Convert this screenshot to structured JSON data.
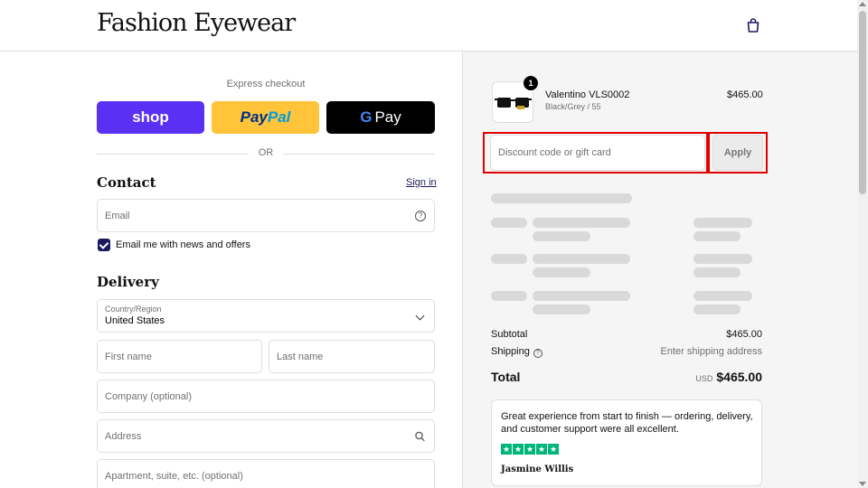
{
  "header": {
    "logo": "Fashion Eyewear",
    "bag_icon": "shopping-bag-icon"
  },
  "express": {
    "label": "Express checkout",
    "shop_label": "shop",
    "paypal_label_1": "Pay",
    "paypal_label_2": "Pal",
    "gpay_g": "G",
    "gpay_label": "Pay",
    "or_label": "OR"
  },
  "contact": {
    "title": "Contact",
    "sign_in": "Sign in",
    "email_placeholder": "Email",
    "news_checkbox_label": "Email me with news and offers",
    "news_checked": true
  },
  "delivery": {
    "title": "Delivery",
    "country_label": "Country/Region",
    "country_value": "United States",
    "first_name_placeholder": "First name",
    "last_name_placeholder": "Last name",
    "company_placeholder": "Company (optional)",
    "address_placeholder": "Address",
    "apartment_placeholder": "Apartment, suite, etc. (optional)"
  },
  "order": {
    "product": {
      "name": "Valentino VLS0002",
      "variant": "Black/Grey / 55",
      "price": "$465.00",
      "quantity": "1"
    },
    "discount_placeholder": "Discount code or gift card",
    "apply_label": "Apply",
    "subtotal_label": "Subtotal",
    "subtotal_value": "$465.00",
    "shipping_label": "Shipping",
    "shipping_value": "Enter shipping address",
    "total_label": "Total",
    "total_currency": "USD",
    "total_value": "$465.00"
  },
  "review": {
    "text": "Great experience from start to finish — ordering, delivery, and customer support were all excellent.",
    "rating": 5,
    "reviewer": "Jasmine Willis"
  },
  "colors": {
    "shop_pay": "#5a31f4",
    "paypal": "#ffc439",
    "gpay": "#000000",
    "accent": "#1a1a5e",
    "highlight": "#e00000",
    "trustpilot": "#00b67a"
  }
}
